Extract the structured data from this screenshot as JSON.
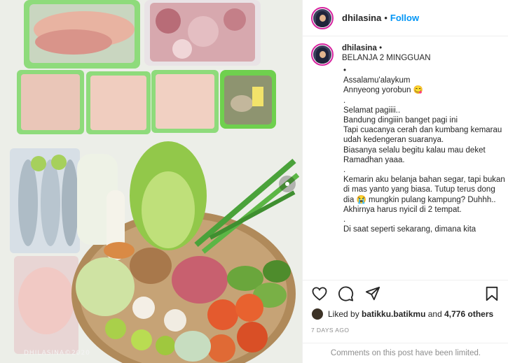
{
  "post": {
    "watermark": "DHILASINA©2020"
  },
  "header": {
    "username": "dhilasina",
    "separator": "•",
    "follow_label": "Follow"
  },
  "caption": {
    "username": "dhilasina",
    "verified_dot": "•",
    "title": "BELANJA 2 MINGGUAN",
    "body": "•\nAssalamu'alaykum\nAnnyeong yorobun 😋\n.\nSelamat pagiiii..\nBandung dingiiin banget pagi ini\nTapi cuacanya cerah dan kumbang kemarau udah kedengeran suaranya.\nBiasanya selalu begitu kalau mau deket Ramadhan yaaa.\n.\nKemarin aku belanja bahan segar, tapi bukan di mas yanto yang biasa. Tutup terus dong dia 😭 mungkin pulang kampung? Duhhh.. Akhirnya harus nyicil di 2 tempat.\n.\nDi saat seperti sekarang, dimana kita"
  },
  "actions": {
    "like": "heart-icon",
    "comment": "comment-icon",
    "share": "share-icon",
    "save": "bookmark-icon"
  },
  "likes": {
    "prefix": "Liked by",
    "user": "batikku.batikmu",
    "conj": "and",
    "others": "4,776 others"
  },
  "timestamp": "7 DAYS AGO",
  "comments_notice": "Comments on this post have been limited."
}
